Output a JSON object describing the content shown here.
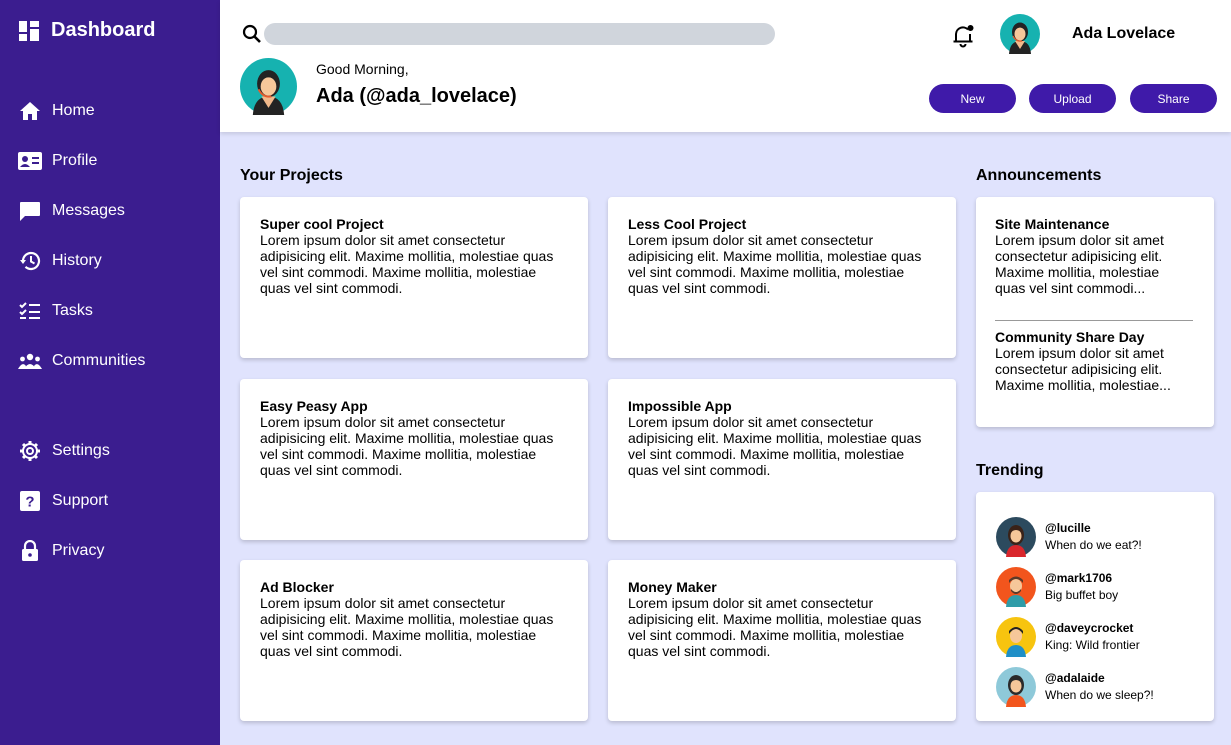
{
  "sidebar": {
    "brand": "Dashboard",
    "items": [
      {
        "label": "Home",
        "icon": "home-icon"
      },
      {
        "label": "Profile",
        "icon": "profile-card-icon"
      },
      {
        "label": "Messages",
        "icon": "message-icon"
      },
      {
        "label": "History",
        "icon": "history-icon"
      },
      {
        "label": "Tasks",
        "icon": "tasks-icon"
      },
      {
        "label": "Communities",
        "icon": "people-icon"
      },
      {
        "label": "Settings",
        "icon": "gear-icon"
      },
      {
        "label": "Support",
        "icon": "help-icon"
      },
      {
        "label": "Privacy",
        "icon": "lock-icon"
      }
    ]
  },
  "header": {
    "search_placeholder": "",
    "user_name": "Ada Lovelace",
    "greeting": "Good Morning,",
    "handle": "Ada (@ada_lovelace)",
    "buttons": {
      "new": "New",
      "upload": "Upload",
      "share": "Share"
    }
  },
  "projects": {
    "title": "Your Projects",
    "items": [
      {
        "title": "Super cool Project",
        "body": "Lorem ipsum dolor sit amet consectetur adipisicing elit. Maxime mollitia, molestiae quas vel sint commodi. Maxime mollitia, molestiae quas vel sint commodi."
      },
      {
        "title": "Less Cool Project",
        "body": "Lorem ipsum dolor sit amet consectetur adipisicing elit. Maxime mollitia, molestiae quas vel sint commodi. Maxime mollitia, molestiae quas vel sint commodi."
      },
      {
        "title": "Easy Peasy App",
        "body": "Lorem ipsum dolor sit amet consectetur adipisicing elit. Maxime mollitia, molestiae quas vel sint commodi. Maxime mollitia, molestiae quas vel sint commodi."
      },
      {
        "title": "Impossible App",
        "body": "Lorem ipsum dolor sit amet consectetur adipisicing elit. Maxime mollitia, molestiae quas vel sint commodi. Maxime mollitia, molestiae quas vel sint commodi."
      },
      {
        "title": "Ad Blocker",
        "body": "Lorem ipsum dolor sit amet consectetur adipisicing elit. Maxime mollitia, molestiae quas vel sint commodi. Maxime mollitia, molestiae quas vel sint commodi."
      },
      {
        "title": "Money Maker",
        "body": "Lorem ipsum dolor sit amet consectetur adipisicing elit. Maxime mollitia, molestiae quas vel sint commodi. Maxime mollitia, molestiae quas vel sint commodi."
      }
    ]
  },
  "announcements": {
    "title": "Announcements",
    "items": [
      {
        "title": "Site Maintenance",
        "body": "Lorem ipsum dolor sit amet consectetur adipisicing elit. Maxime mollitia, molestiae quas vel sint commodi..."
      },
      {
        "title": "Community Share Day",
        "body": "Lorem ipsum dolor sit amet consectetur adipisicing elit. Maxime mollitia, molestiae..."
      }
    ]
  },
  "trending": {
    "title": "Trending",
    "items": [
      {
        "handle": "@lucille",
        "message": "When do we eat?!",
        "color": "#2c4a5e"
      },
      {
        "handle": "@mark1706",
        "message": "Big buffet boy",
        "color": "#f2551d"
      },
      {
        "handle": "@daveycrocket",
        "message": "King: Wild frontier",
        "color": "#f7c40f"
      },
      {
        "handle": "@adalaide",
        "message": "When do we sleep?!",
        "color": "#8ec9d9"
      }
    ]
  },
  "colors": {
    "sidebar": "#3b1d8f",
    "accent": "#3f1aa9",
    "background": "#e0e3fd",
    "avatar_teal": "#16b2b0"
  }
}
